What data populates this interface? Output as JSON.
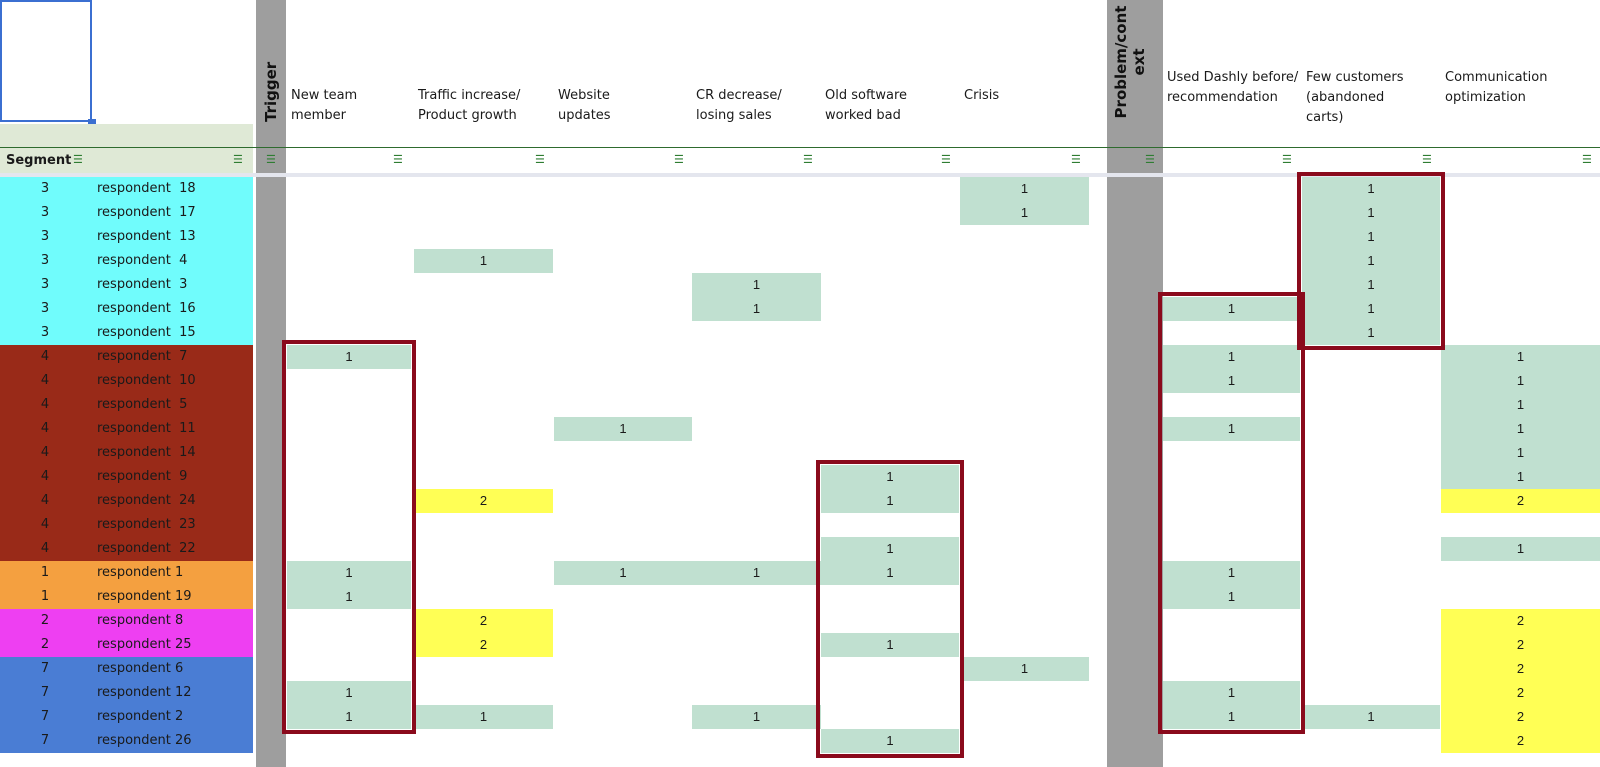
{
  "header": {
    "segment_label": "Segment",
    "group_trigger": "Trigger",
    "group_problem": "Problem/cont ext",
    "columns": [
      {
        "key": "new_team_member",
        "label_lines": [
          "New team",
          "member"
        ]
      },
      {
        "key": "traffic_increase",
        "label_lines": [
          "Traffic increase/",
          "Product growth"
        ]
      },
      {
        "key": "website_updates",
        "label_lines": [
          "Website",
          "updates"
        ]
      },
      {
        "key": "cr_decrease",
        "label_lines": [
          "CR decrease/",
          "losing sales"
        ]
      },
      {
        "key": "old_software",
        "label_lines": [
          "Old software",
          "worked bad"
        ]
      },
      {
        "key": "crisis",
        "label_lines": [
          "Crisis"
        ]
      },
      {
        "key": "used_dashly",
        "label_lines": [
          "Used Dashly before/",
          "recommendation"
        ]
      },
      {
        "key": "few_customers",
        "label_lines": [
          "Few customers",
          "(abandoned",
          "carts)"
        ]
      },
      {
        "key": "communication",
        "label_lines": [
          "Communication",
          "optimization"
        ]
      }
    ]
  },
  "segment_colors": {
    "1": "#f4a040",
    "2": "#ee3ff2",
    "3": "#70fcfc",
    "4": "#992a18",
    "7": "#4a7dd4"
  },
  "value_colors": {
    "1": "#c0e0d0",
    "2": "#ffff55"
  },
  "highlight_color": "#8a0a1c",
  "rows": [
    {
      "segment": "3",
      "respondent": "respondent  18",
      "values": {
        "crisis": 1,
        "few_customers": 1
      }
    },
    {
      "segment": "3",
      "respondent": "respondent  17",
      "values": {
        "crisis": 1,
        "few_customers": 1
      }
    },
    {
      "segment": "3",
      "respondent": "respondent  13",
      "values": {
        "few_customers": 1
      }
    },
    {
      "segment": "3",
      "respondent": "respondent  4",
      "values": {
        "traffic_increase": 1,
        "few_customers": 1
      }
    },
    {
      "segment": "3",
      "respondent": "respondent  3",
      "values": {
        "cr_decrease": 1,
        "few_customers": 1
      }
    },
    {
      "segment": "3",
      "respondent": "respondent  16",
      "values": {
        "cr_decrease": 1,
        "used_dashly": 1,
        "few_customers": 1
      }
    },
    {
      "segment": "3",
      "respondent": "respondent  15",
      "values": {
        "few_customers": 1
      }
    },
    {
      "segment": "4",
      "respondent": "respondent  7",
      "values": {
        "new_team_member": 1,
        "used_dashly": 1,
        "communication": 1
      }
    },
    {
      "segment": "4",
      "respondent": "respondent  10",
      "values": {
        "used_dashly": 1,
        "communication": 1
      }
    },
    {
      "segment": "4",
      "respondent": "respondent  5",
      "values": {
        "communication": 1
      }
    },
    {
      "segment": "4",
      "respondent": "respondent  11",
      "values": {
        "website_updates": 1,
        "used_dashly": 1,
        "communication": 1
      }
    },
    {
      "segment": "4",
      "respondent": "respondent  14",
      "values": {
        "communication": 1
      }
    },
    {
      "segment": "4",
      "respondent": "respondent  9",
      "values": {
        "old_software": 1,
        "communication": 1
      }
    },
    {
      "segment": "4",
      "respondent": "respondent  24",
      "values": {
        "traffic_increase": 2,
        "old_software": 1,
        "communication": 2
      }
    },
    {
      "segment": "4",
      "respondent": "respondent  23",
      "values": {}
    },
    {
      "segment": "4",
      "respondent": "respondent  22",
      "values": {
        "old_software": 1,
        "communication": 1
      }
    },
    {
      "segment": "1",
      "respondent": "respondent 1",
      "values": {
        "new_team_member": 1,
        "website_updates": 1,
        "cr_decrease": 1,
        "old_software": 1,
        "used_dashly": 1
      }
    },
    {
      "segment": "1",
      "respondent": "respondent 19",
      "values": {
        "new_team_member": 1,
        "used_dashly": 1
      }
    },
    {
      "segment": "2",
      "respondent": "respondent 8",
      "values": {
        "traffic_increase": 2,
        "communication": 2
      }
    },
    {
      "segment": "2",
      "respondent": "respondent 25",
      "values": {
        "traffic_increase": 2,
        "old_software": 1,
        "communication": 2
      }
    },
    {
      "segment": "7",
      "respondent": "respondent 6",
      "values": {
        "crisis": 1,
        "communication": 2
      }
    },
    {
      "segment": "7",
      "respondent": "respondent 12",
      "values": {
        "new_team_member": 1,
        "used_dashly": 1,
        "communication": 2
      }
    },
    {
      "segment": "7",
      "respondent": "respondent 2",
      "values": {
        "new_team_member": 1,
        "traffic_increase": 1,
        "cr_decrease": 1,
        "used_dashly": 1,
        "few_customers": 1,
        "communication": 2
      }
    },
    {
      "segment": "7",
      "respondent": "respondent 26",
      "values": {
        "old_software": 1,
        "communication": 2
      }
    }
  ],
  "highlight_boxes": [
    {
      "column": "new_team_member",
      "from_row": 7,
      "to_row": 22
    },
    {
      "column": "old_software",
      "from_row": 12,
      "to_row": 23
    },
    {
      "column": "used_dashly",
      "from_row": 5,
      "to_row": 22
    },
    {
      "column": "few_customers",
      "from_row": 0,
      "to_row": 6
    }
  ]
}
